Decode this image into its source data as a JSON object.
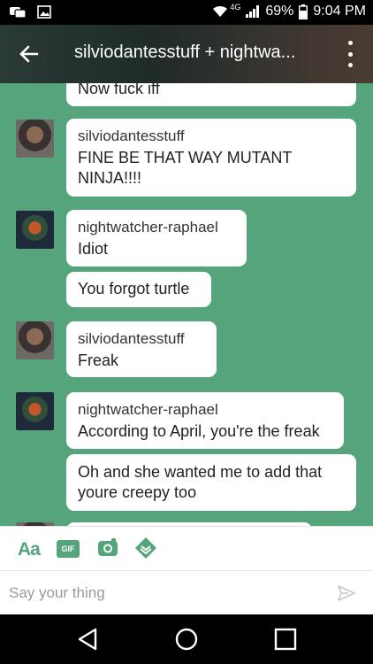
{
  "status_bar": {
    "network": "4G",
    "battery": "69%",
    "time": "9:04 PM"
  },
  "header": {
    "title": "silviodantesstuff + nightwa..."
  },
  "messages": [
    {
      "type": "partial",
      "text": "Now fuck iff"
    },
    {
      "sender": "silviodantesstuff",
      "text": "FINE BE THAT WAY MUTANT NINJA!!!!"
    },
    {
      "sender": "nightwatcher-raphael",
      "text": "Idiot"
    },
    {
      "type": "followup",
      "text": "You forgot turtle"
    },
    {
      "sender": "silviodantesstuff",
      "text": "Freak"
    },
    {
      "sender": "nightwatcher-raphael",
      "text": "According to April, you're the freak"
    },
    {
      "type": "followup",
      "text": "Oh and she wanted me to add that youre creepy too"
    }
  ],
  "toolbar": {
    "text_style": "Aa",
    "gif": "GIF",
    "icons": [
      "text-style-icon",
      "gif-icon",
      "camera-icon",
      "sticker-icon"
    ]
  },
  "composer": {
    "placeholder": "Say your thing"
  },
  "colors": {
    "accent": "#56a47b",
    "bubble": "#ffffff"
  }
}
